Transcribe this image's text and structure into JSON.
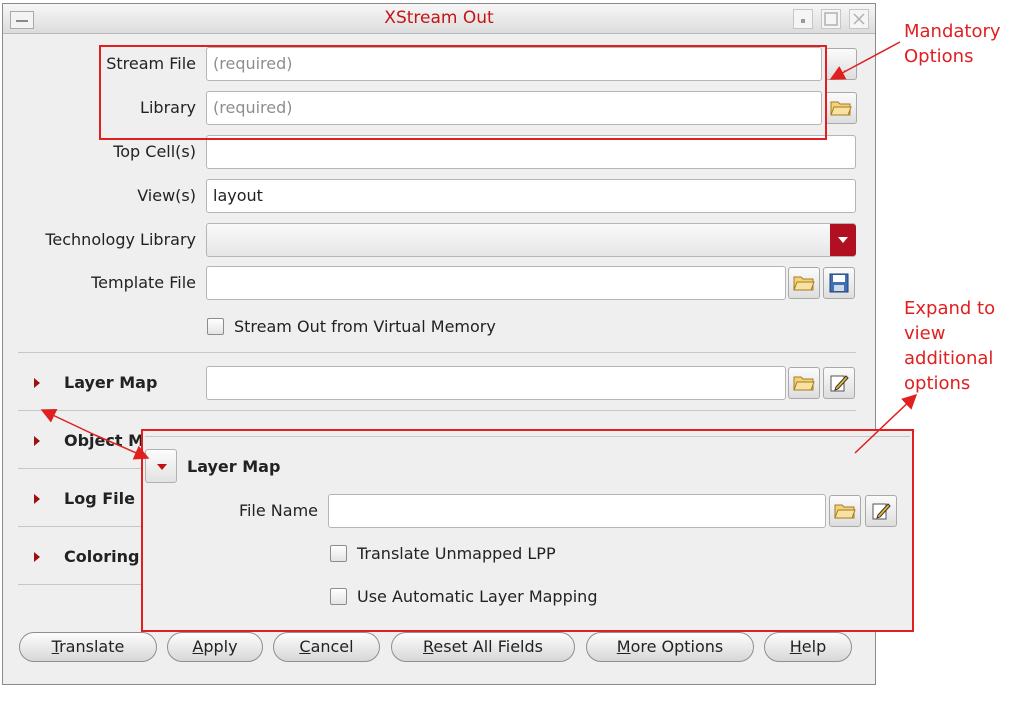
{
  "window": {
    "title": "XStream Out"
  },
  "fields": {
    "stream_file": {
      "label": "Stream File",
      "placeholder": "(required)",
      "browse": "..."
    },
    "library": {
      "label": "Library",
      "placeholder": "(required)"
    },
    "top_cells": {
      "label": "Top Cell(s)",
      "value": ""
    },
    "views": {
      "label": "View(s)",
      "value": "layout"
    },
    "technology_library": {
      "label": "Technology Library",
      "value": ""
    },
    "template_file": {
      "label": "Template File",
      "value": ""
    },
    "stream_virtual": {
      "label": "Stream Out from Virtual Memory",
      "checked": false
    }
  },
  "sections": [
    {
      "label": "Layer Map"
    },
    {
      "label": "Object M"
    },
    {
      "label": "Log File"
    },
    {
      "label": "Coloring"
    }
  ],
  "buttons": {
    "translate": "Translate",
    "apply": "Apply",
    "cancel": "Cancel",
    "reset": "Reset All Fields",
    "more": "More Options",
    "help": "Help"
  },
  "inset": {
    "title": "Layer Map",
    "file_name_label": "File Name",
    "file_name_value": "",
    "translate_unmapped": "Translate Unmapped LPP",
    "auto_mapping": "Use Automatic Layer Mapping"
  },
  "annotations": {
    "mandatory": [
      "Mandatory",
      "Options"
    ],
    "expand": [
      "Expand to",
      "view",
      "additional",
      "options"
    ]
  },
  "colors": {
    "annotation_red": "#e02020",
    "title_red": "#c41414",
    "dropdown_red": "#b01020",
    "panel_bg": "#efefef"
  }
}
